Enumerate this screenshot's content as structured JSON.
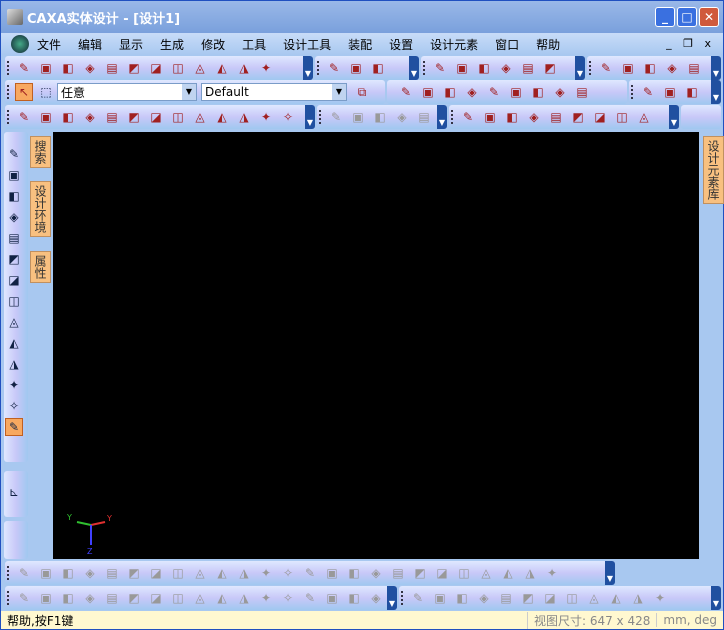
{
  "title": "CAXA实体设计 - [设计1]",
  "menu": [
    "文件",
    "编辑",
    "显示",
    "生成",
    "修改",
    "工具",
    "设计工具",
    "装配",
    "设置",
    "设计元素",
    "窗口",
    "帮助"
  ],
  "selectors": {
    "filter": "任意",
    "style": "Default"
  },
  "toolbars": {
    "row1a": [
      "new-icon",
      "new-drawing-icon",
      "open-icon",
      "save-icon",
      "undo-icon",
      "redo-icon",
      "rotate-icon",
      "copy-icon",
      "lock-icon",
      "binoculars-icon",
      "smart-snap-icon",
      "help-cursor-icon"
    ],
    "row1b": [
      "assembly-icon",
      "triball-icon",
      "toolbox-icon"
    ],
    "row1c": [
      "extrude-icon",
      "spin-icon",
      "sweep-icon",
      "loft-icon",
      "text-icon",
      "image-icon"
    ],
    "row1d": [
      "arrow-icon",
      "face-icon",
      "plane-icon",
      "layer-icon",
      "formula-icon"
    ],
    "row2a": [
      "wireframe-icon",
      "box-icon",
      "sphere-icon",
      "shaded-sphere-icon"
    ],
    "row2b": [
      "perspective-icon",
      "view-box-icon",
      "cylinder-icon",
      "calendar-icon",
      "render-icon"
    ],
    "row2c": [
      "cube-red-icon",
      "cube-wire-icon",
      "cube-face-icon"
    ],
    "row3a": [
      "curve1-icon",
      "curve2-icon",
      "curve3-icon",
      "curve4-icon",
      "curve5-icon",
      "curve6-icon",
      "curve7-icon",
      "curve8-icon",
      "curve9-icon",
      "curve10-icon",
      "curve11-icon",
      "curve12-icon",
      "curve13-icon"
    ],
    "row3b": [
      "feature1-icon",
      "feature2-icon",
      "feature3-icon",
      "corner-icon",
      "corner2-icon"
    ],
    "row3c": [
      "section1-icon",
      "section2-icon",
      "section3-icon",
      "ladder-icon",
      "fold1-icon",
      "fold2-icon",
      "fold3-icon",
      "fold4-icon",
      "fold5-icon"
    ],
    "bottom1": [
      "line-icon",
      "line2-icon",
      "line3-icon",
      "point-icon",
      "polyline-icon",
      "arc-icon",
      "rect-icon",
      "diamond-icon",
      "hexagon-icon",
      "circle1-icon",
      "circle2-icon",
      "circle3-icon",
      "circle4-icon",
      "circle5-icon",
      "circle6-icon",
      "arc1-icon",
      "arc2-icon",
      "arc3-icon",
      "spline1-icon",
      "spline2-icon",
      "spline3-icon",
      "spline4-icon",
      "stack1-icon",
      "stack2-icon",
      "stack3-icon"
    ],
    "bottom2a": [
      "tag-icon",
      "angle-icon",
      "bowtie-icon",
      "fan-icon",
      "horizontal-icon",
      "vertical-icon",
      "perpendicular-icon",
      "parallel-icon",
      "tangent-icon",
      "equal-icon",
      "concentric-icon",
      "diag1-icon",
      "diag2-icon",
      "diag3-icon",
      "dim1-icon",
      "dim2-icon",
      "dim3-icon"
    ],
    "bottom2b": [
      "array1-icon",
      "scale-icon",
      "rotate2-icon",
      "grid-icon",
      "ring-icon",
      "mirror-icon",
      "offset-icon",
      "trim1-icon",
      "trim2-icon",
      "cut-icon",
      "extend-icon",
      "delete-icon"
    ],
    "left": [
      "move-icon",
      "orbit-icon",
      "walk-icon",
      "fly-icon",
      "zoom-icon",
      "zoom-box-icon",
      "zoom-fit-icon",
      "target-icon",
      "camera-move-icon",
      "camera1-icon",
      "camera2-icon",
      "camera3-icon",
      "camera4-icon",
      "paint-icon"
    ]
  },
  "side_tabs": {
    "left": [
      "搜索",
      "设计环境",
      "属性"
    ],
    "right": "设计元素库"
  },
  "status": {
    "help": "帮助,按F1键",
    "view_size": "视图尺寸: 647 x 428",
    "units": "mm, deg"
  }
}
